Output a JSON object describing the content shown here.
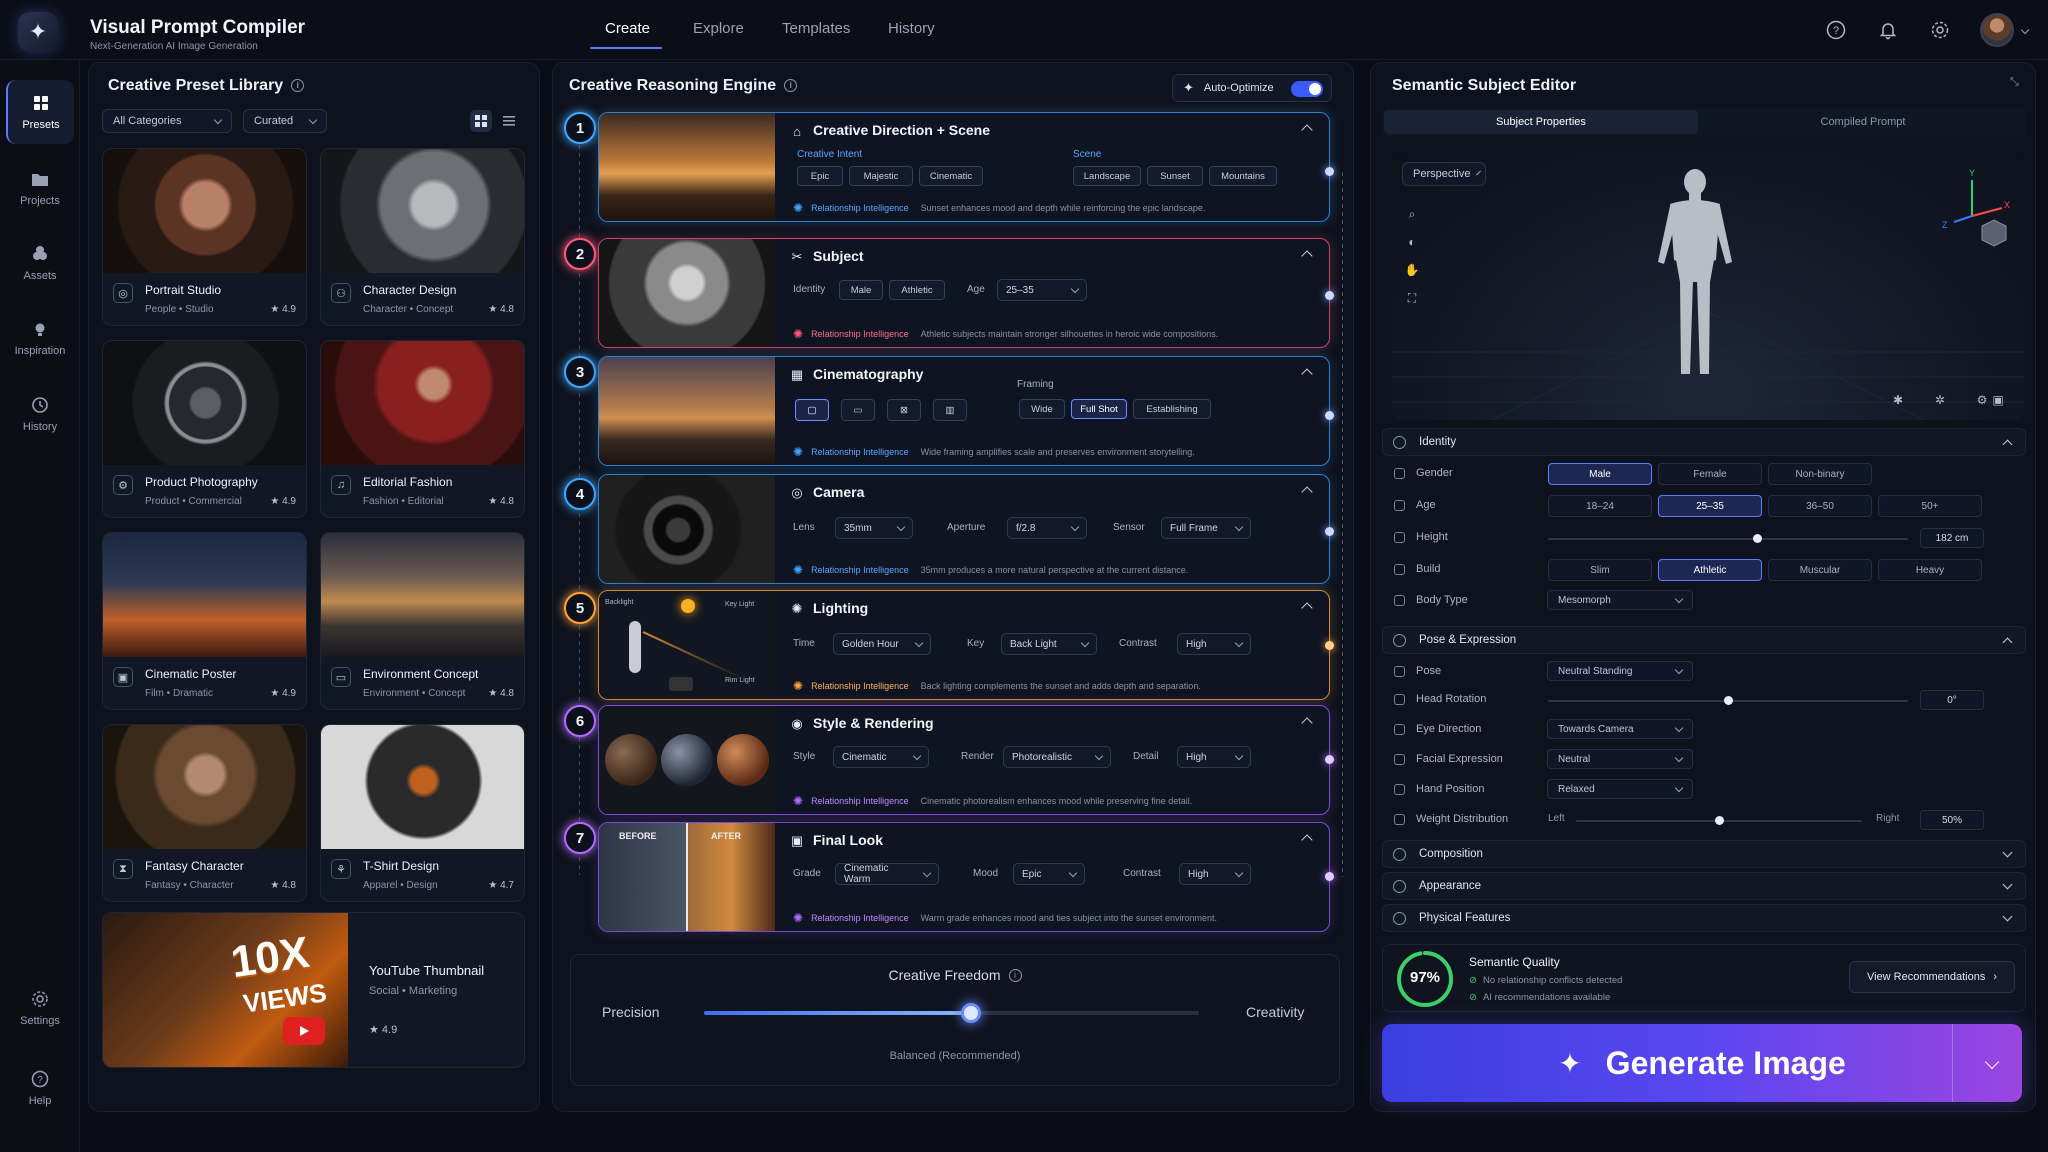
{
  "app": {
    "title": "Visual Prompt Compiler",
    "subtitle": "Next-Generation AI Image Generation"
  },
  "nav": {
    "tabs": [
      "Create",
      "Explore",
      "Templates",
      "History"
    ],
    "active": "Create"
  },
  "rail": {
    "items": [
      "Presets",
      "Projects",
      "Assets",
      "Inspiration",
      "History"
    ],
    "bottom": [
      "Settings",
      "Help"
    ]
  },
  "library": {
    "title": "Creative Preset Library",
    "filter_category": "All Categories",
    "filter_sort": "Curated",
    "presets": [
      {
        "name": "Portrait Studio",
        "category": "People • Studio",
        "rating": "★ 4.9"
      },
      {
        "name": "Character Design",
        "category": "Character • Concept",
        "rating": "★ 4.8"
      },
      {
        "name": "Product Photography",
        "category": "Product • Commercial",
        "rating": "★ 4.9"
      },
      {
        "name": "Editorial Fashion",
        "category": "Fashion • Editorial",
        "rating": "★ 4.8"
      },
      {
        "name": "Cinematic Poster",
        "category": "Film • Dramatic",
        "rating": "★ 4.9"
      },
      {
        "name": "Environment Concept",
        "category": "Environment • Concept",
        "rating": "★ 4.8"
      },
      {
        "name": "Fantasy Character",
        "category": "Fantasy • Character",
        "rating": "★ 4.8"
      },
      {
        "name": "T-Shirt Design",
        "category": "Apparel • Design",
        "rating": "★ 4.7"
      },
      {
        "name": "YouTube Thumbnail",
        "category": "Social • Marketing",
        "rating": "★ 4.9"
      }
    ],
    "thumb_text_big": "10X",
    "thumb_text_small": "VIEWS"
  },
  "engine": {
    "title": "Creative Reasoning Engine",
    "auto_optimize": "Auto-Optimize",
    "rel_label": "Relationship Intelligence",
    "steps": [
      {
        "num": "1",
        "title": "Creative Direction + Scene",
        "group1": "Creative Intent",
        "chips1": [
          "Epic",
          "Majestic",
          "Cinematic"
        ],
        "group2": "Scene",
        "chips2": [
          "Landscape",
          "Sunset",
          "Mountains"
        ],
        "ri": "Sunset enhances mood and depth while reinforcing the epic landscape."
      },
      {
        "num": "2",
        "title": "Subject",
        "identity_label": "Identity",
        "chips": [
          "Male",
          "Athletic"
        ],
        "age_label": "Age",
        "age": "25–35",
        "ri": "Athletic subjects maintain stronger silhouettes in heroic wide compositions."
      },
      {
        "num": "3",
        "title": "Cinematography",
        "framing_label": "Framing",
        "framing": [
          "Wide",
          "Full Shot",
          "Establishing"
        ],
        "ri": "Wide framing amplifies scale and preserves environment storytelling."
      },
      {
        "num": "4",
        "title": "Camera",
        "fields": [
          {
            "label": "Lens",
            "value": "35mm"
          },
          {
            "label": "Aperture",
            "value": "f/2.8"
          },
          {
            "label": "Sensor",
            "value": "Full Frame"
          }
        ],
        "ri": "35mm produces a more natural perspective at the current distance."
      },
      {
        "num": "5",
        "title": "Lighting",
        "fields": [
          {
            "label": "Time",
            "value": "Golden Hour"
          },
          {
            "label": "Key",
            "value": "Back Light"
          },
          {
            "label": "Contrast",
            "value": "High"
          }
        ],
        "ri": "Back lighting complements the sunset and adds depth and separation.",
        "diagram": {
          "backlight": "Backlight",
          "keylight": "Key Light",
          "rimlight": "Rim Light"
        }
      },
      {
        "num": "6",
        "title": "Style & Rendering",
        "fields": [
          {
            "label": "Style",
            "value": "Cinematic"
          },
          {
            "label": "Render",
            "value": "Photorealistic"
          },
          {
            "label": "Detail",
            "value": "High"
          }
        ],
        "ri": "Cinematic photorealism enhances mood while preserving fine detail."
      },
      {
        "num": "7",
        "title": "Final Look",
        "fields": [
          {
            "label": "Grade",
            "value": "Cinematic Warm"
          },
          {
            "label": "Mood",
            "value": "Epic"
          },
          {
            "label": "Contrast",
            "value": "High"
          }
        ],
        "ri": "Warm grade enhances mood and ties subject into the sunset environment.",
        "before": "BEFORE",
        "after": "AFTER"
      }
    ],
    "freedom": {
      "title": "Creative Freedom",
      "left": "Precision",
      "right": "Creativity",
      "caption": "Balanced (Recommended)",
      "value": 0.54
    }
  },
  "editor": {
    "title": "Semantic Subject Editor",
    "tabs": [
      "Subject Properties",
      "Compiled Prompt"
    ],
    "view": "Perspective",
    "axes": {
      "x": "X",
      "y": "Y",
      "z": "Z"
    },
    "identity": {
      "title": "Identity",
      "gender_label": "Gender",
      "genders": [
        "Male",
        "Female",
        "Non-binary"
      ],
      "gender_sel": 0,
      "age_label": "Age",
      "ages": [
        "18–24",
        "25–35",
        "36–50",
        "50+"
      ],
      "age_sel": 1,
      "height_label": "Height",
      "height": "182 cm",
      "height_level": 0.58,
      "build_label": "Build",
      "builds": [
        "Slim",
        "Athletic",
        "Muscular",
        "Heavy"
      ],
      "build_sel": 1,
      "bodytype_label": "Body Type",
      "bodytype": "Mesomorph"
    },
    "pose": {
      "title": "Pose & Expression",
      "pose_label": "Pose",
      "pose": "Neutral Standing",
      "rotation_label": "Head Rotation",
      "rotation": "0°",
      "rotation_level": 0.5,
      "eye_label": "Eye Direction",
      "eye": "Towards Camera",
      "face_label": "Facial Expression",
      "face": "Neutral",
      "hand_label": "Hand Position",
      "hand": "Relaxed",
      "weight_label": "Weight Distribution",
      "weight_left": "Left",
      "weight_right": "Right",
      "weight": "50%",
      "weight_level": 0.5
    },
    "collapsed": [
      "Composition",
      "Appearance",
      "Physical Features"
    ],
    "quality": {
      "title": "Semantic Quality",
      "score": "97%",
      "score_level": 0.97,
      "line1": "No relationship conflicts detected",
      "line2": "AI recommendations available",
      "button": "View Recommendations"
    },
    "generate": "Generate Image"
  }
}
